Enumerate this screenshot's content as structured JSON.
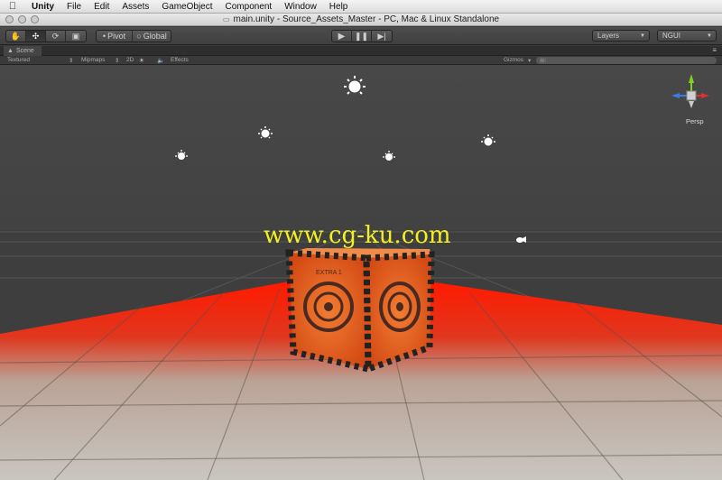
{
  "menubar": {
    "app": "Unity",
    "items": [
      "File",
      "Edit",
      "Assets",
      "GameObject",
      "Component",
      "Window",
      "Help"
    ]
  },
  "window": {
    "title": "main.unity - Source_Assets_Master - PC, Mac & Linux Standalone"
  },
  "toolbar": {
    "pivot": "Pivot",
    "global": "Global",
    "layers": "Layers",
    "layout": "NGUI"
  },
  "scene_tab": {
    "label": "Scene"
  },
  "scene_options": {
    "draw_mode": "Textured",
    "render_mode": "Mipmaps",
    "mode_2d": "2D",
    "effects": "Effects",
    "gizmos": "Gizmos",
    "search_placeholder": "All"
  },
  "viewport": {
    "projection": "Persp",
    "watermark": "www.cg-ku.com",
    "crate_label": "EXTRA 1"
  },
  "colors": {
    "floor_glow": "#ff1e00",
    "crate": "#f06a1a",
    "watermark": "#f3f022"
  }
}
